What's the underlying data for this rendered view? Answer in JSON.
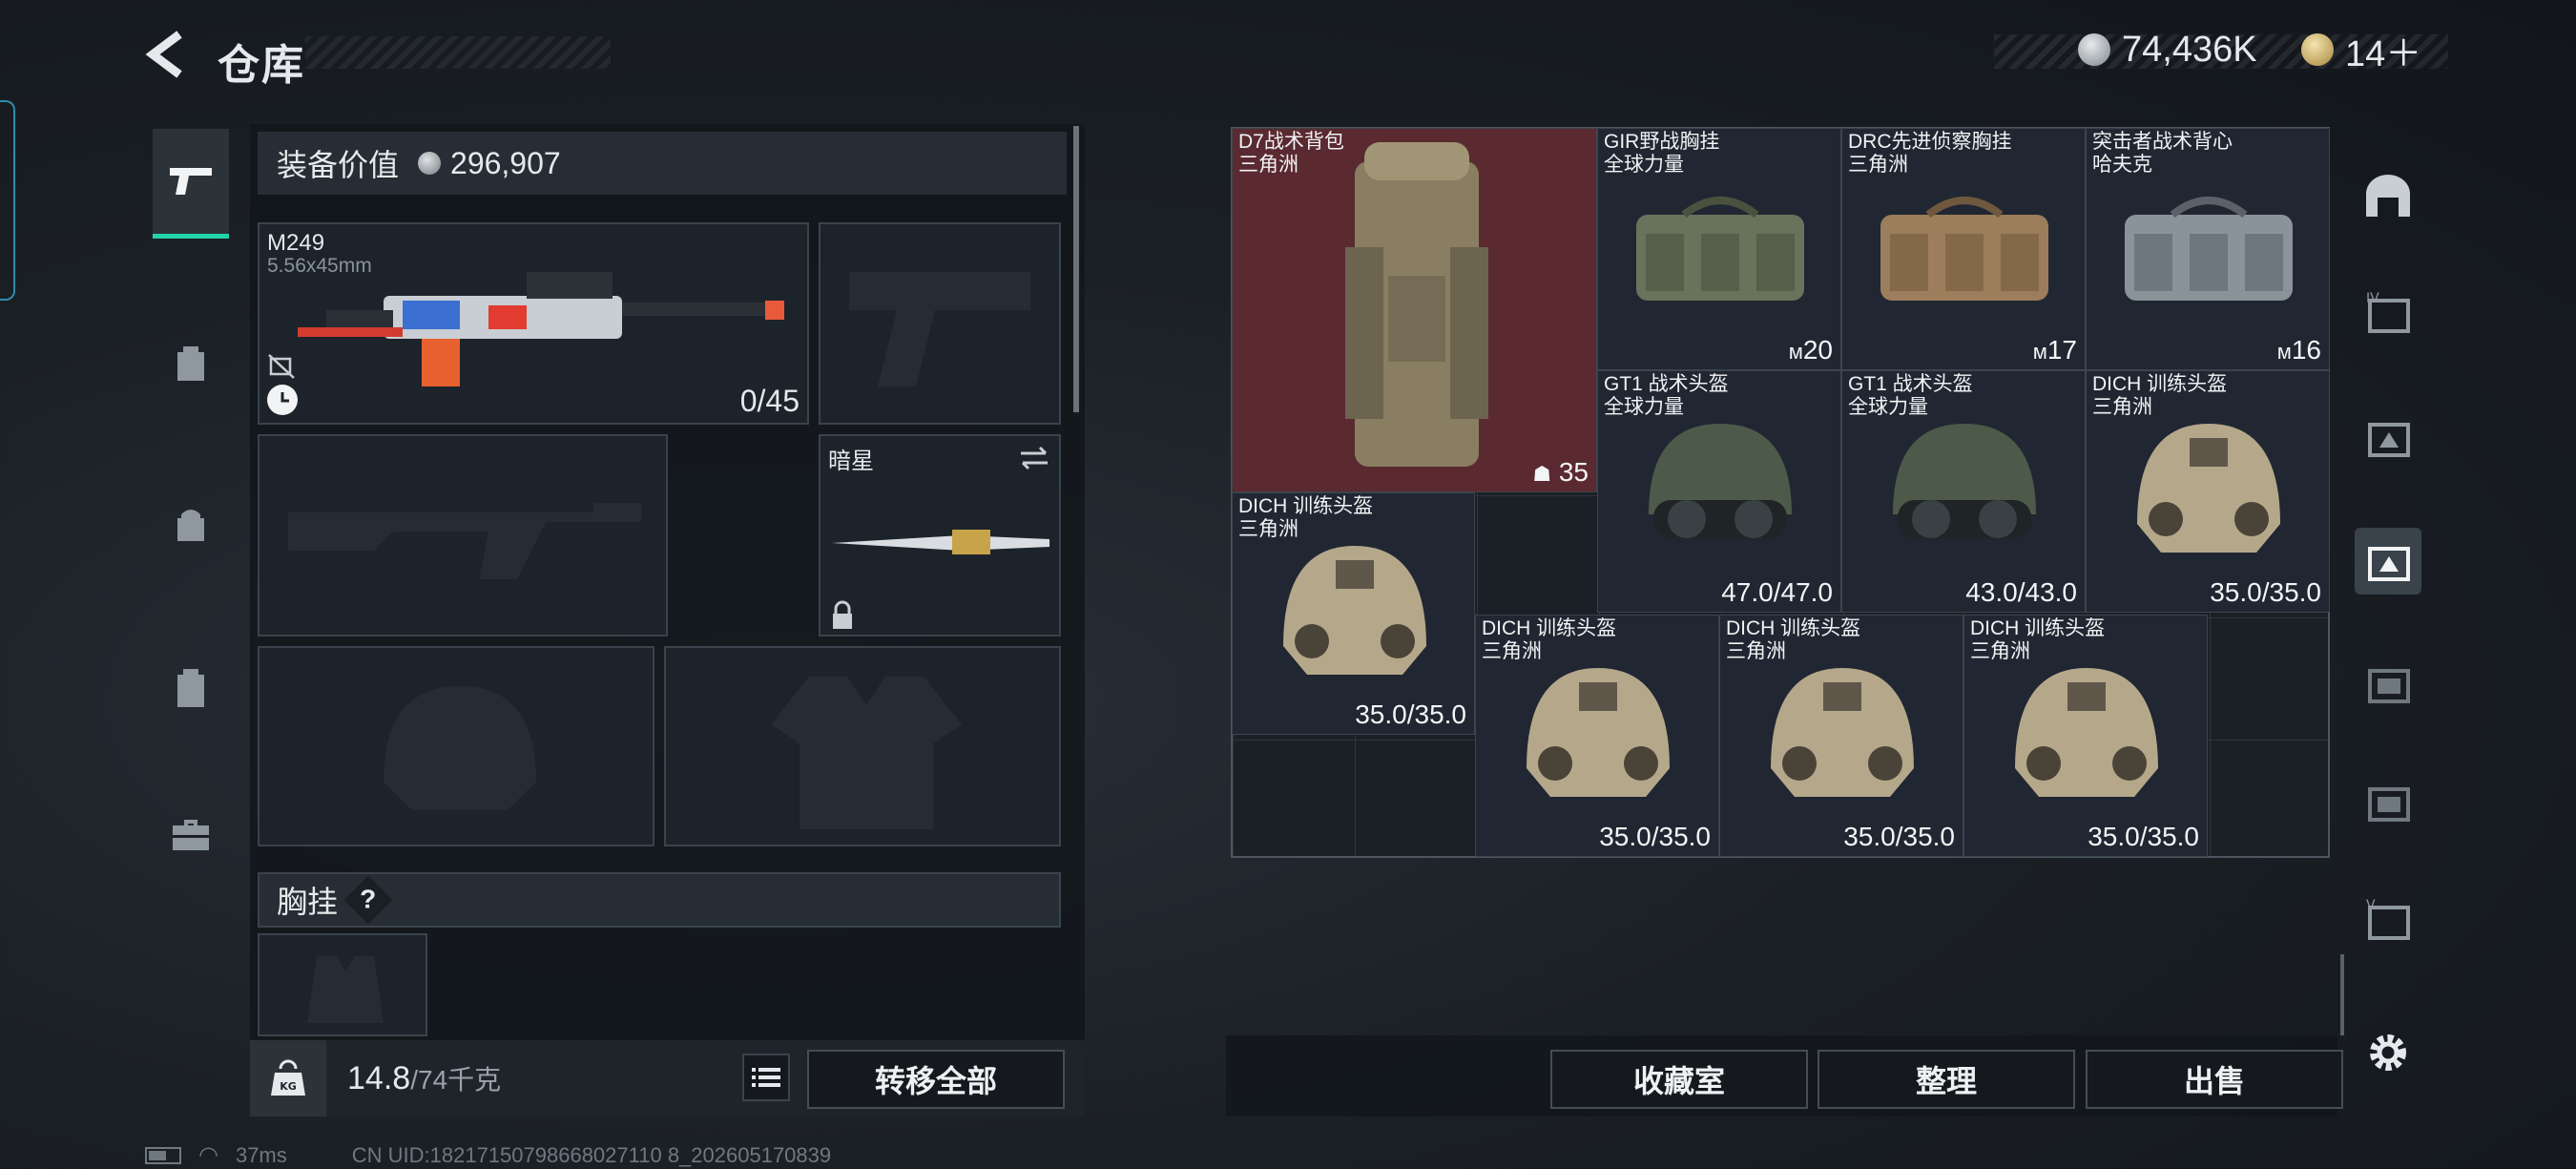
{
  "header": {
    "title": "仓库",
    "currency_silver": "74,436K",
    "currency_gold": "14＋"
  },
  "left_tabs": [
    {
      "icon": "pistol-icon",
      "active": true
    },
    {
      "icon": "backpack-icon",
      "active": false
    },
    {
      "icon": "bag-icon",
      "active": false
    },
    {
      "icon": "clipboard-icon",
      "active": false
    },
    {
      "icon": "briefcase-icon",
      "active": false
    }
  ],
  "equipment": {
    "value_label": "装备价值",
    "value": "296,907",
    "primary_weapon": {
      "name": "M249",
      "caliber": "5.56x45mm",
      "ammo": "0/45"
    },
    "melee": {
      "name": "暗星"
    },
    "chest_rig_label": "胸挂",
    "help": "?"
  },
  "footer_left": {
    "weight": "14.8",
    "capacity": "/74千克",
    "kg_label": "KG",
    "transfer_all": "转移全部"
  },
  "grid_items": [
    {
      "name": "D7战术背包",
      "maker": "三角洲",
      "value": "35",
      "value_icon": "person-icon",
      "highlight": "red"
    },
    {
      "name": "GIR野战胸挂",
      "maker": "全球力量",
      "value": "20",
      "value_icon": "rig-icon"
    },
    {
      "name": "DRC先进侦察胸挂",
      "maker": "三角洲",
      "value": "17",
      "value_icon": "rig-icon"
    },
    {
      "name": "突击者战术背心",
      "maker": "哈夫克",
      "value": "16",
      "value_icon": "rig-icon"
    },
    {
      "name": "GT1 战术头盔",
      "maker": "全球力量",
      "value": "47.0/47.0"
    },
    {
      "name": "GT1 战术头盔",
      "maker": "全球力量",
      "value": "43.0/43.0"
    },
    {
      "name": "DICH 训练头盔",
      "maker": "三角洲",
      "value": "35.0/35.0"
    },
    {
      "name": "DICH 训练头盔",
      "maker": "三角洲",
      "value": "35.0/35.0"
    },
    {
      "name": "DICH 训练头盔",
      "maker": "三角洲",
      "value": "35.0/35.0"
    },
    {
      "name": "DICH 训练头盔",
      "maker": "三角洲",
      "value": "35.0/35.0"
    },
    {
      "name": "DICH 训练头盔",
      "maker": "三角洲",
      "value": "35.0/35.0"
    }
  ],
  "footer_right": {
    "collection": "收藏室",
    "sort": "整理",
    "sell": "出售"
  },
  "status": {
    "ping": "37ms",
    "uid": "CN UID:18217150798668027110 8_202605170839"
  },
  "colors": {
    "accent": "#21d4a8",
    "panel": "#1d232a",
    "backpack_highlight": "#5a2a30",
    "item_bg": "#202732"
  }
}
